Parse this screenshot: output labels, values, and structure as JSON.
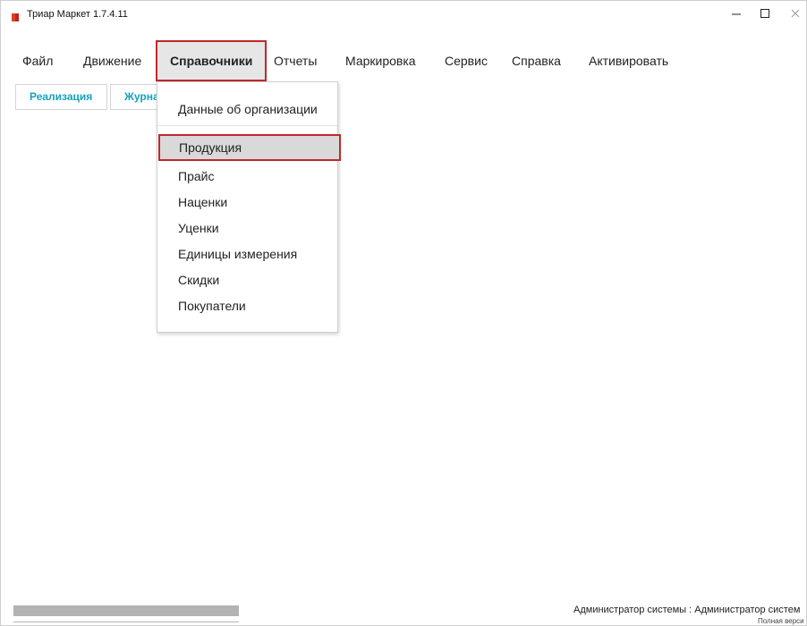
{
  "window": {
    "title": "Триар Маркет 1.7.4.11"
  },
  "menu": {
    "items": [
      "Файл",
      "Движение",
      "Справочники",
      "Отчеты",
      "Маркировка",
      "Сервис",
      "Справка",
      "Активировать"
    ]
  },
  "toolbar": {
    "buttons": [
      "Реализация",
      "Журна"
    ]
  },
  "dropdown": {
    "header": "Данные об организации",
    "items": [
      "Продукция",
      "Прайс",
      "Наценки",
      "Уценки",
      "Единицы измерения",
      "Скидки",
      "Покупатели"
    ]
  },
  "status": {
    "user": "Администратор системы : Администратор систем",
    "version": "Полная верси"
  },
  "colors": {
    "accent": "#17a2b8",
    "highlight_border": "#c0282b",
    "app_icon": "#e0401f"
  }
}
